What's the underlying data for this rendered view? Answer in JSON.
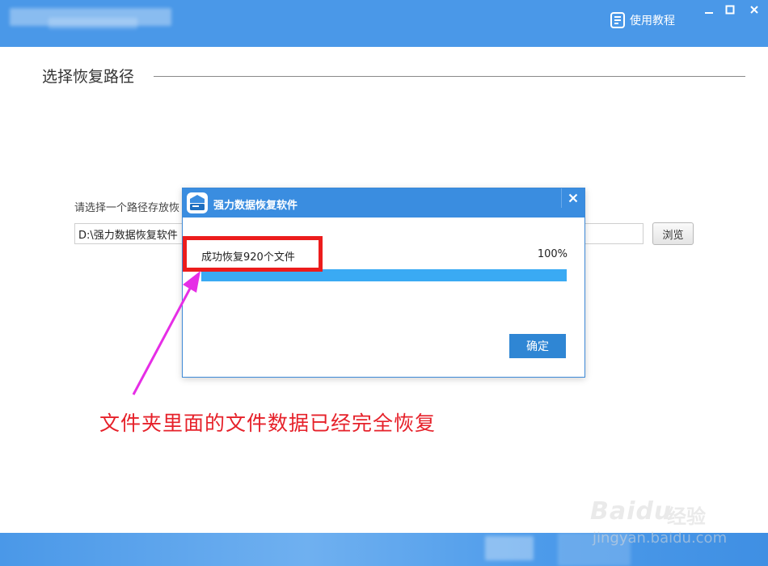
{
  "window": {
    "tutorial_label": "使用教程",
    "controls": [
      "minimize",
      "maximize",
      "close"
    ]
  },
  "section": {
    "title": "选择恢复路径"
  },
  "path_form": {
    "prompt": "请选择一个路径存放恢",
    "path_value": "D:\\强力数据恢复软件",
    "browse_label": "浏览"
  },
  "dialog": {
    "title": "强力数据恢复软件",
    "status": "成功恢复920个文件",
    "progress_percent_label": "100%",
    "progress_fraction": 1.0,
    "ok_label": "确定"
  },
  "annotation": {
    "text": "文件夹里面的文件数据已经完全恢复",
    "color": "#e6212a"
  },
  "watermark": {
    "brand": "Baidu",
    "jingyan": "经验",
    "url": "jingyan.baidu.com"
  },
  "colors": {
    "titlebar": "#4a98e8",
    "dialog_header": "#3a8de0",
    "progress": "#3aaaf3",
    "highlight": "#ec1c1c",
    "arrow": "#e62ee6"
  }
}
